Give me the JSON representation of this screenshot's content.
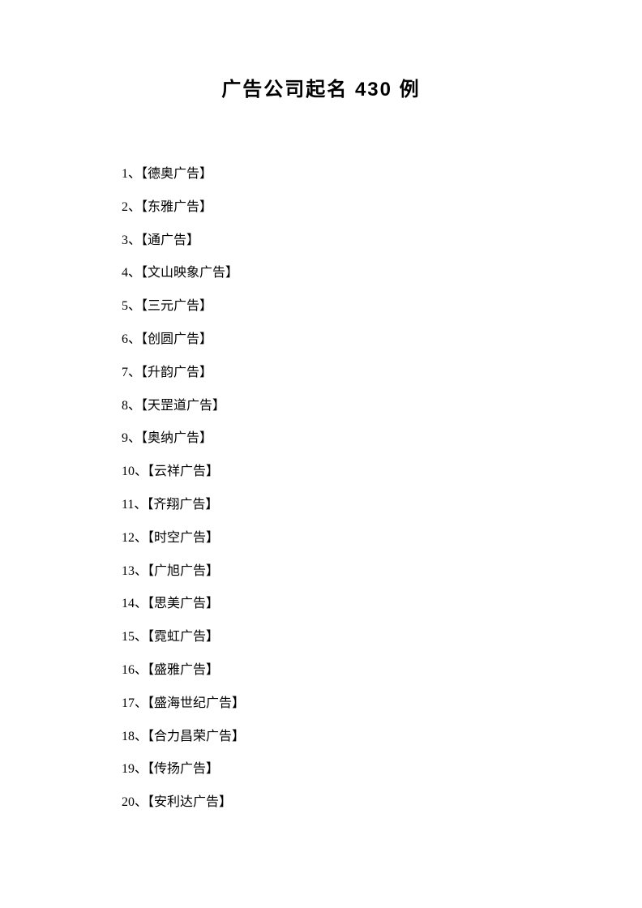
{
  "title": "广告公司起名 430 例",
  "items": [
    "1、【德奥广告】",
    "2、【东雅广告】",
    "3、【通广告】",
    "4、【文山映象广告】",
    "5、【三元广告】",
    "6、【创圆广告】",
    "7、【升韵广告】",
    "8、【天罡道广告】",
    "9、【奥纳广告】",
    "10、【云祥广告】",
    "11、【齐翔广告】",
    "12、【时空广告】",
    "13、【广旭广告】",
    "14、【思美广告】",
    "15、【霓虹广告】",
    "16、【盛雅广告】",
    "17、【盛海世纪广告】",
    "18、【合力昌荣广告】",
    "19、【传扬广告】",
    "20、【安利达广告】"
  ]
}
